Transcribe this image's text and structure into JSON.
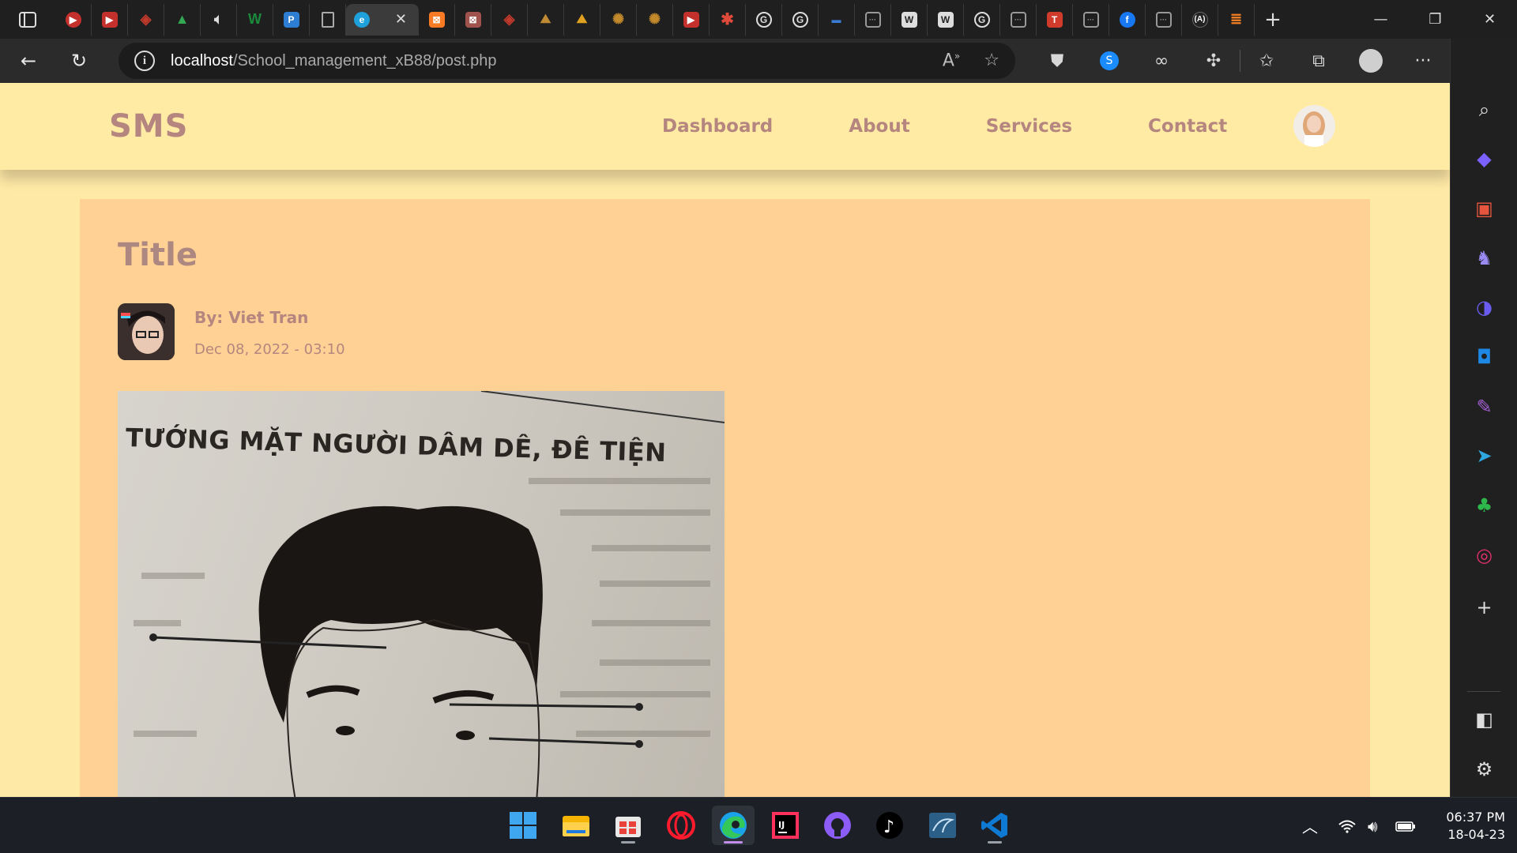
{
  "browser": {
    "tabs": [
      {
        "icon": "youtube-icon",
        "color": "#c4302b"
      },
      {
        "icon": "youtube-icon",
        "color": "#c4302b"
      },
      {
        "icon": "diamond-icon",
        "color": "#c0392b"
      },
      {
        "icon": "drive-icon",
        "color": "#34a853"
      },
      {
        "icon": "audio-icon",
        "color": "#dddddd"
      },
      {
        "icon": "w-icon",
        "color": "#1b8a3a"
      },
      {
        "icon": "p-icon",
        "color": "#2d7dd2"
      },
      {
        "icon": "document-icon",
        "color": "#dddddd"
      },
      {
        "icon": "edge-icon",
        "color": "#1ea0db"
      },
      {
        "icon": "xampp-icon",
        "color": "#fb7a24"
      },
      {
        "icon": "xampp-icon",
        "color": "#a0524d"
      },
      {
        "icon": "diamond-icon",
        "color": "#c0392b"
      },
      {
        "icon": "mountain-icon",
        "color": "#c08a35"
      },
      {
        "icon": "mountain-icon",
        "color": "#e0a020"
      },
      {
        "icon": "seal-icon",
        "color": "#c28a2b"
      },
      {
        "icon": "seal-icon",
        "color": "#c28a2b"
      },
      {
        "icon": "youtube-icon",
        "color": "#c4302b"
      },
      {
        "icon": "asterisk-icon",
        "color": "#e04a3a"
      },
      {
        "icon": "google-icon",
        "color": "#dddddd"
      },
      {
        "icon": "google-icon",
        "color": "#dddddd"
      },
      {
        "icon": "terminal-icon",
        "color": "#3a7bd5"
      },
      {
        "icon": "page-icon",
        "color": "#aaaaaa"
      },
      {
        "icon": "wikipedia-icon",
        "color": "#dddddd"
      },
      {
        "icon": "wikipedia-icon",
        "color": "#dddddd"
      },
      {
        "icon": "google-icon",
        "color": "#dddddd"
      },
      {
        "icon": "page-icon",
        "color": "#aaaaaa"
      },
      {
        "icon": "t-icon",
        "color": "#d13b2c"
      },
      {
        "icon": "page-icon",
        "color": "#aaaaaa"
      },
      {
        "icon": "facebook-icon",
        "color": "#1877f2"
      },
      {
        "icon": "page-icon",
        "color": "#aaaaaa"
      },
      {
        "icon": "a-icon",
        "color": "#dddddd"
      },
      {
        "icon": "stackoverflow-icon",
        "color": "#f48024"
      }
    ],
    "active_tab_index": 8,
    "url_host": "localhost",
    "url_path": "/School_management_xB88/post.php"
  },
  "site": {
    "logo": "SMS",
    "nav": [
      "Dashboard",
      "About",
      "Services",
      "Contact"
    ]
  },
  "post": {
    "title": "Title",
    "author": "By: Viet Tran",
    "date": "Dec 08, 2022 - 03:10",
    "image_caption": "TƯỚNG MẶT NGƯỜI DÂM DÊ, ĐÊ TIỆN"
  },
  "sidebar": {
    "icons": [
      "search-icon",
      "tag-icon",
      "briefcase-icon",
      "games-icon",
      "copilot-icon",
      "outlook-icon",
      "designer-icon",
      "send-icon",
      "tree-icon",
      "instagram-icon",
      "add-icon",
      "split-screen-icon",
      "settings-icon"
    ]
  },
  "taskbar": {
    "apps": [
      "windows-start-icon",
      "file-explorer-icon",
      "store-icon",
      "opera-icon",
      "edge-icon",
      "intellij-icon",
      "github-icon",
      "tiktok-icon",
      "mysql-workbench-icon",
      "vscode-icon"
    ],
    "time": "06:37 PM",
    "date": "18-04-23"
  },
  "colors": {
    "page_bg": "#ffe9a6",
    "card_bg": "#ffd194",
    "text_brand": "#b4867f"
  }
}
